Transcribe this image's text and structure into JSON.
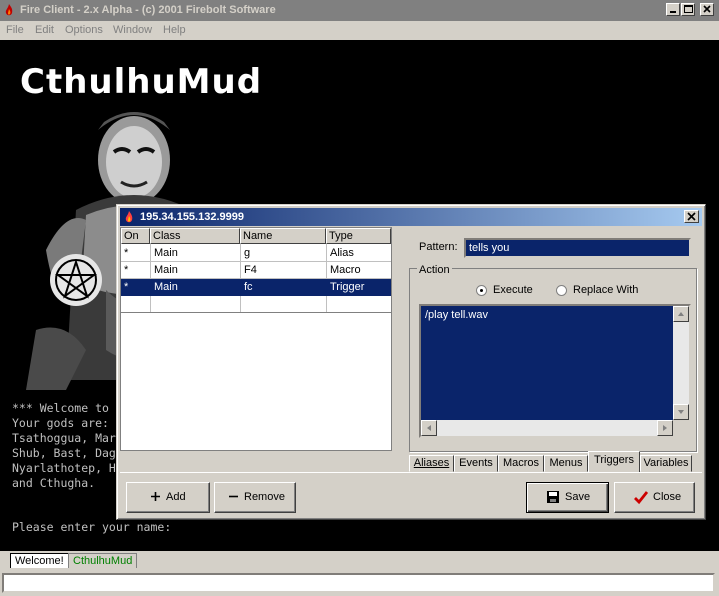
{
  "app": {
    "title": "Fire Client - 2.x Alpha - (c) 2001 Firebolt Software"
  },
  "menu": {
    "items": [
      "File",
      "Edit",
      "Options",
      "Window",
      "Help"
    ]
  },
  "terminal": {
    "logo": "CthulhuMud",
    "lines": [
      "*** Welcome to",
      "Your gods are:",
      "Tsathoggua, Mar",
      "Shub, Bast, Dag",
      "Nyarlathotep, H",
      "and Cthugha."
    ],
    "prompt": "Please enter your name:"
  },
  "window_tabs": [
    "Welcome!",
    "CthulhuMud"
  ],
  "dialog": {
    "title": "195.34.155.132.9999",
    "columns": [
      "On",
      "Class",
      "Name",
      "Type"
    ],
    "rows": [
      {
        "on": "*",
        "class": "Main",
        "name": "g",
        "type": "Alias",
        "selected": false
      },
      {
        "on": "*",
        "class": "Main",
        "name": "F4",
        "type": "Macro",
        "selected": false
      },
      {
        "on": "*",
        "class": "Main",
        "name": "fc",
        "type": "Trigger",
        "selected": true
      }
    ],
    "pattern_label": "Pattern:",
    "pattern_value": "tells you",
    "action_label": "Action",
    "radio_execute": "Execute",
    "radio_replace": "Replace With",
    "action_text": "/play tell.wav",
    "tabs": [
      "Aliases",
      "Events",
      "Macros",
      "Menus",
      "Triggers",
      "Variables"
    ],
    "active_tab": "Triggers",
    "buttons": {
      "add": "Add",
      "remove": "Remove",
      "save": "Save",
      "close": "Close"
    }
  },
  "colors": {
    "selection": "#0a246a",
    "terminal_bg": "#000000",
    "face": "#d4d0c8"
  }
}
